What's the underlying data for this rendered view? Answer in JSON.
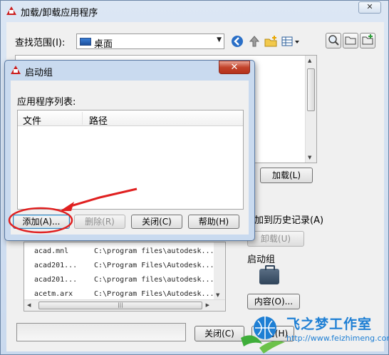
{
  "main_window": {
    "title": "加载/卸载应用程序",
    "close_glyph": "✕",
    "look_in": {
      "label": "查找范围(I):",
      "value": "桌面"
    },
    "toolbar": {
      "back_icon": "back-arrow-icon",
      "up_icon": "up-folder-icon",
      "new_folder_icon": "new-folder-icon",
      "views_icon": "views-menu-icon",
      "right_tools": [
        "find-icon",
        "folder-icon",
        "favorites-icon"
      ]
    },
    "load_button": "加载(L)",
    "add_to_history": "加到历史记录(A)",
    "unload_button": "卸载(U)",
    "startup_suite": {
      "label": "启动组",
      "contents_button": "内容(O)..."
    },
    "loaded_apps": [
      {
        "name": "acad.mnl",
        "path": "C:\\program files\\autodesk..."
      },
      {
        "name": "acad201...",
        "path": "C:\\Program Files\\Autodesk..."
      },
      {
        "name": "acad201...",
        "path": "C:\\program files\\autodesk..."
      },
      {
        "name": "acetm.arx",
        "path": "C:\\Program Files\\Autodesk..."
      }
    ],
    "close_button": "关闭(C)",
    "help_button": "帮助(H)"
  },
  "dialog": {
    "title": "启动组",
    "close_glyph": "✕",
    "list_label": "应用程序列表:",
    "columns": [
      "文件",
      "路径"
    ],
    "buttons": {
      "add": "添加(A)...",
      "remove": "删除(R)",
      "close": "关闭(C)",
      "help": "帮助(H)"
    }
  },
  "annotation": {
    "color": "#e02020"
  },
  "watermark": {
    "text": "飞之梦工作室",
    "url": "http://www.feizhimeng.com"
  }
}
